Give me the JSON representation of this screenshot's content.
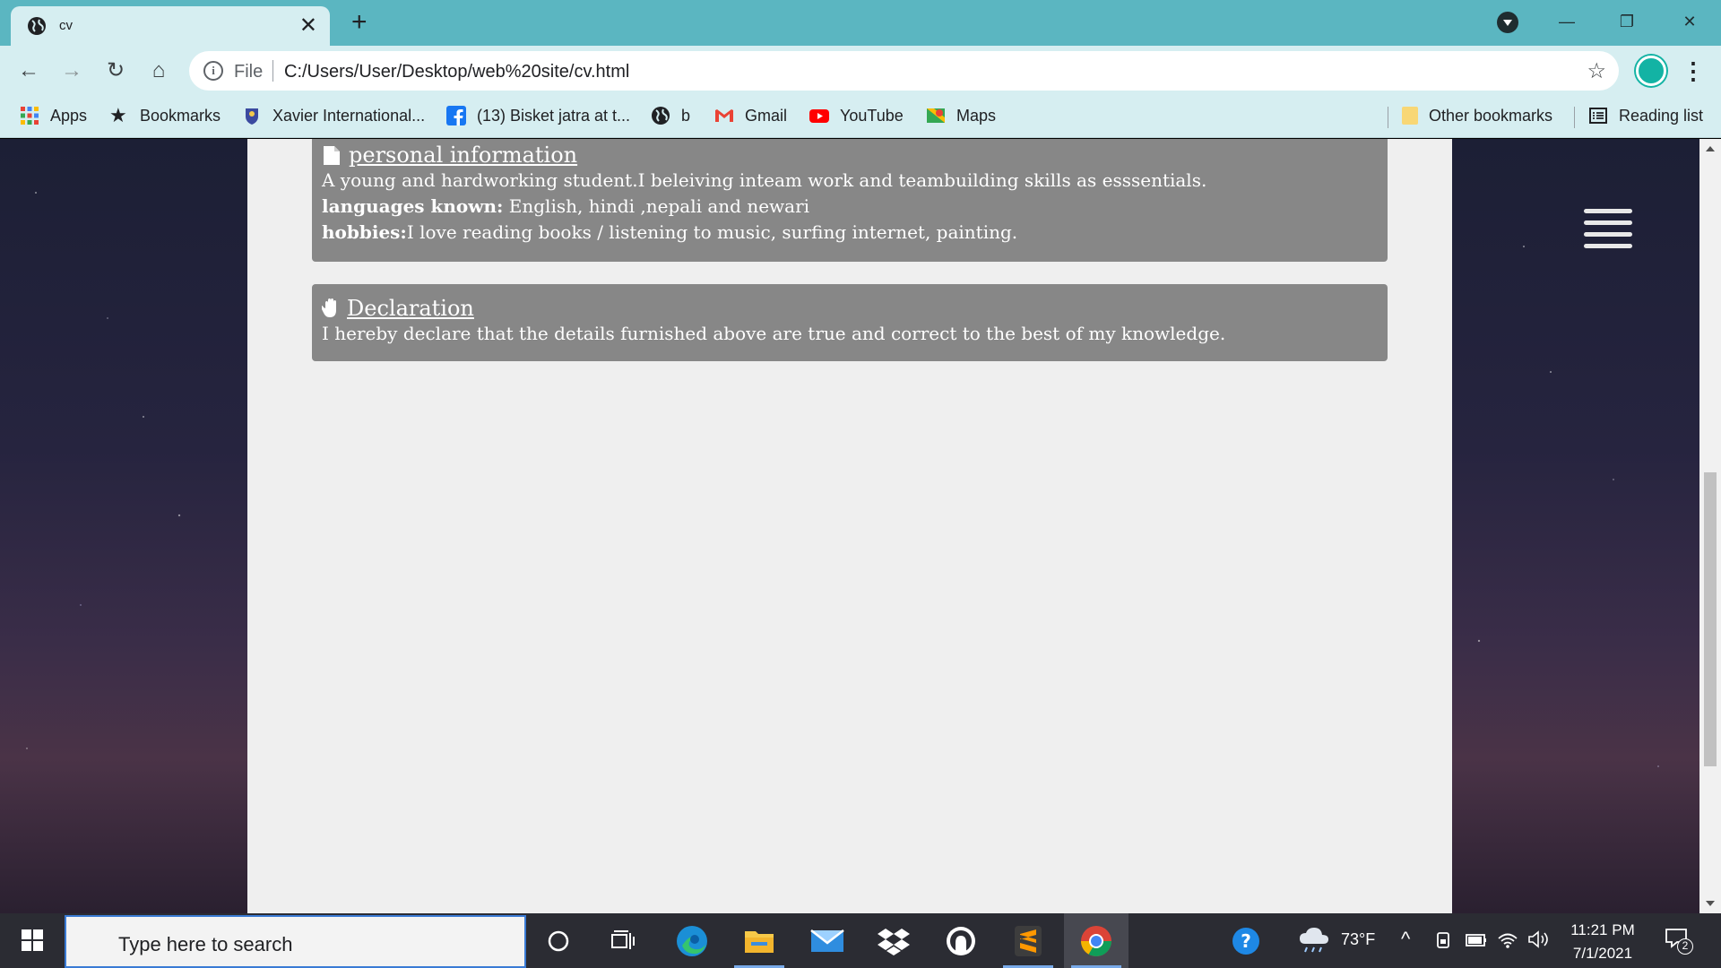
{
  "browser": {
    "tab_title": "cv",
    "new_tab_symbol": "+",
    "close_tab_symbol": "✕",
    "omnibox_scheme": "File",
    "url": "C:/Users/User/Desktop/web%20site/cv.html",
    "window_controls": {
      "minimize": "—",
      "restore": "❐",
      "close": "✕"
    }
  },
  "bookmarks": {
    "items": [
      {
        "label": "Apps",
        "icon": "apps-grid-icon"
      },
      {
        "label": "Bookmarks",
        "icon": "star-icon"
      },
      {
        "label": "Xavier International...",
        "icon": "school-crest-icon"
      },
      {
        "label": "(13) Bisket jatra at t...",
        "icon": "facebook-icon"
      },
      {
        "label": "b",
        "icon": "globe-icon"
      },
      {
        "label": "Gmail",
        "icon": "gmail-icon"
      },
      {
        "label": "YouTube",
        "icon": "youtube-icon"
      },
      {
        "label": "Maps",
        "icon": "maps-icon"
      }
    ],
    "other": "Other bookmarks",
    "reading_list": "Reading list"
  },
  "page": {
    "personal": {
      "heading": "personal information",
      "summary": "A young and hardworking student.I beleiving inteam work and teambuilding skills as esssentials.",
      "languages_label": "languages known:",
      "languages_value": " English, hindi ,nepali and newari",
      "hobbies_label": "hobbies:",
      "hobbies_value": "I love reading books / listening to music, surfing internet, painting."
    },
    "declaration": {
      "heading": "Declaration",
      "text": "I hereby declare that the details furnished above are true and correct to the best of my knowledge."
    }
  },
  "taskbar": {
    "search_placeholder": "Type here to search",
    "weather": "73°F",
    "time": "11:21 PM",
    "date": "7/1/2021",
    "notification_count": "2"
  },
  "colors": {
    "tabbar": "#5bb6c1",
    "toolbar": "#d6eef1",
    "card": "#878787",
    "page": "#efefef",
    "taskbar": "#2b2c33"
  }
}
